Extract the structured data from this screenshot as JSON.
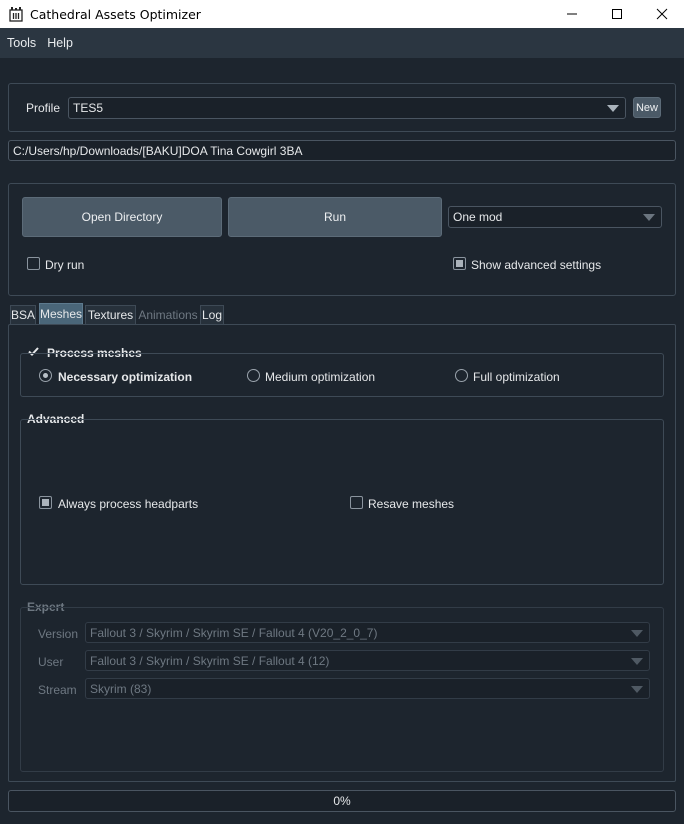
{
  "window": {
    "title": "Cathedral Assets Optimizer"
  },
  "menu": {
    "items": [
      "Tools",
      "Help"
    ]
  },
  "profile": {
    "label": "Profile",
    "value": "TES5",
    "new_button": "New"
  },
  "path": {
    "value": "C:/Users/hp/Downloads/[BAKU]DOA Tina Cowgirl 3BA"
  },
  "actions": {
    "open_directory": "Open Directory",
    "run": "Run",
    "mode": "One mod",
    "dry_run": "Dry run",
    "dry_run_checked": false,
    "show_advanced": "Show advanced settings",
    "show_advanced_checked": true
  },
  "tabs": [
    {
      "label": "BSA",
      "state": "normal"
    },
    {
      "label": "Meshes",
      "state": "active"
    },
    {
      "label": "Textures",
      "state": "normal"
    },
    {
      "label": "Animations",
      "state": "disabled"
    },
    {
      "label": "Log",
      "state": "normal"
    }
  ],
  "meshes": {
    "process_label": "Process meshes",
    "process_checked": true,
    "options": [
      {
        "label": "Necessary optimization",
        "selected": true
      },
      {
        "label": "Medium optimization",
        "selected": false
      },
      {
        "label": "Full optimization",
        "selected": false
      }
    ]
  },
  "advanced": {
    "title": "Advanced",
    "always_headparts": "Always process headparts",
    "always_headparts_checked": true,
    "resave_meshes": "Resave meshes",
    "resave_meshes_checked": false
  },
  "expert": {
    "title": "Expert",
    "version_label": "Version",
    "version_value": "Fallout 3 / Skyrim / Skyrim SE / Fallout 4 (V20_2_0_7)",
    "user_label": "User",
    "user_value": "Fallout 3 / Skyrim / Skyrim SE / Fallout 4 (12)",
    "stream_label": "Stream",
    "stream_value": "Skyrim (83)"
  },
  "progress": {
    "value": 0,
    "text": "0%"
  }
}
